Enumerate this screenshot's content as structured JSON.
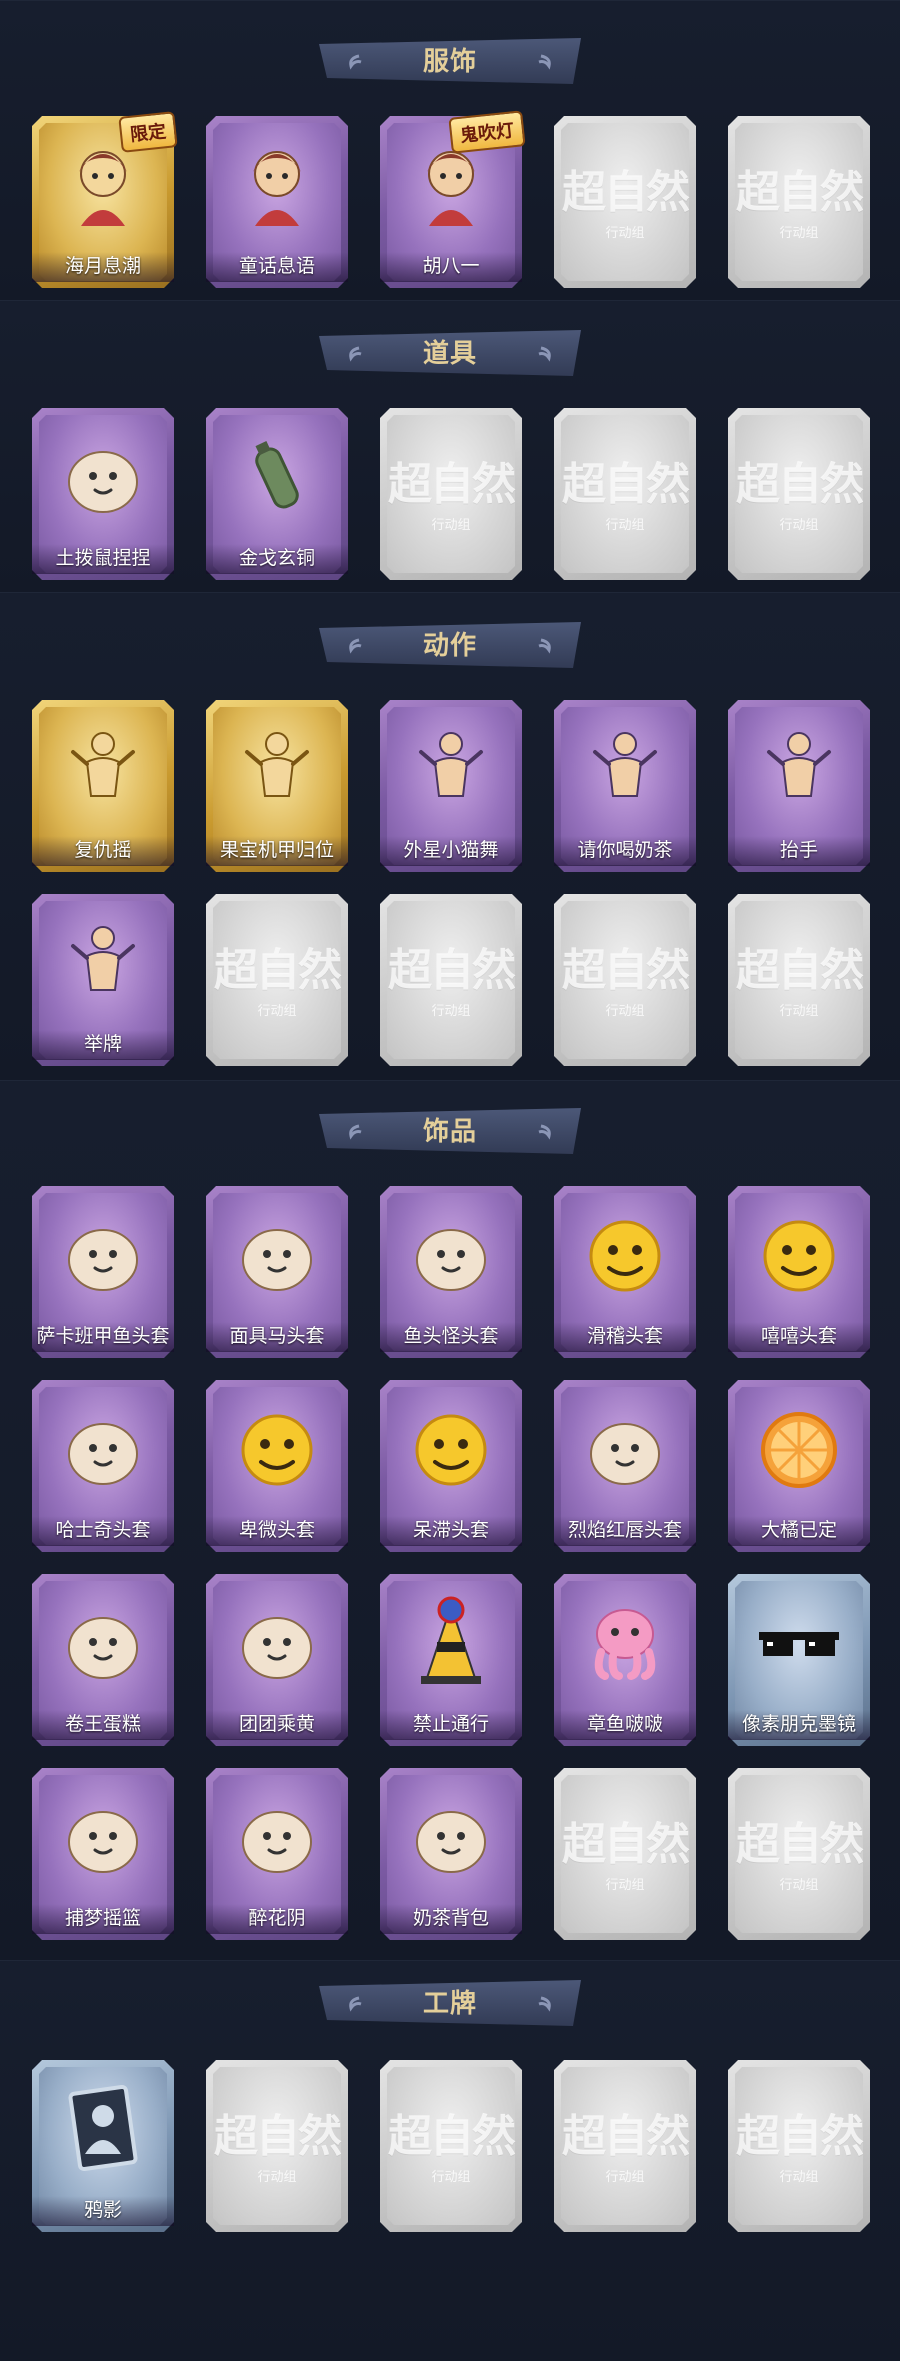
{
  "sections": [
    {
      "title": "服饰",
      "items": [
        {
          "label": "海月息潮",
          "tier": "gold",
          "icon": "mermaid-costume-icon",
          "badge": "限定"
        },
        {
          "label": "童话息语",
          "tier": "purple",
          "icon": "fairy-girl-costume-icon"
        },
        {
          "label": "胡八一",
          "tier": "purple",
          "icon": "warrior-costume-icon",
          "badge": "鬼吹灯"
        },
        {
          "label": "",
          "tier": "empty"
        },
        {
          "label": "",
          "tier": "empty"
        }
      ]
    },
    {
      "title": "道具",
      "items": [
        {
          "label": "土拨鼠捏捏",
          "tier": "purple",
          "icon": "marmot-toy-icon"
        },
        {
          "label": "金戈玄铜",
          "tier": "purple",
          "icon": "bronze-grenade-icon"
        },
        {
          "label": "",
          "tier": "empty"
        },
        {
          "label": "",
          "tier": "empty"
        },
        {
          "label": "",
          "tier": "empty"
        }
      ]
    },
    {
      "title": "动作",
      "items": [
        {
          "label": "复仇摇",
          "tier": "gold",
          "icon": "dance-pose-icon"
        },
        {
          "label": "果宝机甲归位",
          "tier": "gold",
          "icon": "mech-pose-icon"
        },
        {
          "label": "外星小猫舞",
          "tier": "purple",
          "icon": "cat-dance-pose-icon"
        },
        {
          "label": "请你喝奶茶",
          "tier": "purple",
          "icon": "milk-tea-pose-icon"
        },
        {
          "label": "抬手",
          "tier": "purple",
          "icon": "raise-hand-pose-icon"
        },
        {
          "label": "举牌",
          "tier": "purple",
          "icon": "hold-sign-pose-icon"
        },
        {
          "label": "",
          "tier": "empty"
        },
        {
          "label": "",
          "tier": "empty"
        },
        {
          "label": "",
          "tier": "empty"
        },
        {
          "label": "",
          "tier": "empty"
        }
      ]
    },
    {
      "title": "饰品",
      "items": [
        {
          "label": "萨卡班甲鱼头套",
          "tier": "purple",
          "icon": "fish-head-mask-icon"
        },
        {
          "label": "面具马头套",
          "tier": "purple",
          "icon": "horse-head-mask-icon"
        },
        {
          "label": "鱼头怪头套",
          "tier": "purple",
          "icon": "fishman-mask-icon"
        },
        {
          "label": "滑稽头套",
          "tier": "purple",
          "icon": "funny-face-mask-icon"
        },
        {
          "label": "嘻嘻头套",
          "tier": "purple",
          "icon": "grin-face-mask-icon"
        },
        {
          "label": "哈士奇头套",
          "tier": "purple",
          "icon": "husky-mask-icon"
        },
        {
          "label": "卑微头套",
          "tier": "purple",
          "icon": "humble-face-mask-icon"
        },
        {
          "label": "呆滞头套",
          "tier": "purple",
          "icon": "dazed-face-mask-icon"
        },
        {
          "label": "烈焰红唇头套",
          "tier": "purple",
          "icon": "red-lips-mask-icon"
        },
        {
          "label": "大橘已定",
          "tier": "purple",
          "icon": "orange-slice-icon"
        },
        {
          "label": "卷王蛋糕",
          "tier": "purple",
          "icon": "roll-cake-icon"
        },
        {
          "label": "团团乘黄",
          "tier": "purple",
          "icon": "cute-beast-icon"
        },
        {
          "label": "禁止通行",
          "tier": "purple",
          "icon": "traffic-cone-icon"
        },
        {
          "label": "章鱼啵啵",
          "tier": "purple",
          "icon": "octopus-icon"
        },
        {
          "label": "像素朋克墨镜",
          "tier": "blue",
          "icon": "pixel-sunglasses-icon"
        },
        {
          "label": "捕梦摇篮",
          "tier": "purple",
          "icon": "dream-catcher-icon"
        },
        {
          "label": "醉花阴",
          "tier": "purple",
          "icon": "flower-hairpin-icon"
        },
        {
          "label": "奶茶背包",
          "tier": "purple",
          "icon": "milk-tea-backpack-icon"
        },
        {
          "label": "",
          "tier": "empty"
        },
        {
          "label": "",
          "tier": "empty"
        }
      ]
    },
    {
      "title": "工牌",
      "items": [
        {
          "label": "鸦影",
          "tier": "blue",
          "icon": "badge-portrait-icon"
        },
        {
          "label": "",
          "tier": "empty"
        },
        {
          "label": "",
          "tier": "empty"
        },
        {
          "label": "",
          "tier": "empty"
        },
        {
          "label": "",
          "tier": "empty"
        }
      ]
    }
  ],
  "placeholder": {
    "logo_main": "超自然",
    "logo_sub": "行动组"
  },
  "colors": {
    "background": "#141a27",
    "header_text": "#e4cf9a",
    "tier_purple": "#8a66b4",
    "tier_gold": "#d9aa3e",
    "tier_blue": "#8ea4bf",
    "tier_empty": "#cfcfcf"
  }
}
